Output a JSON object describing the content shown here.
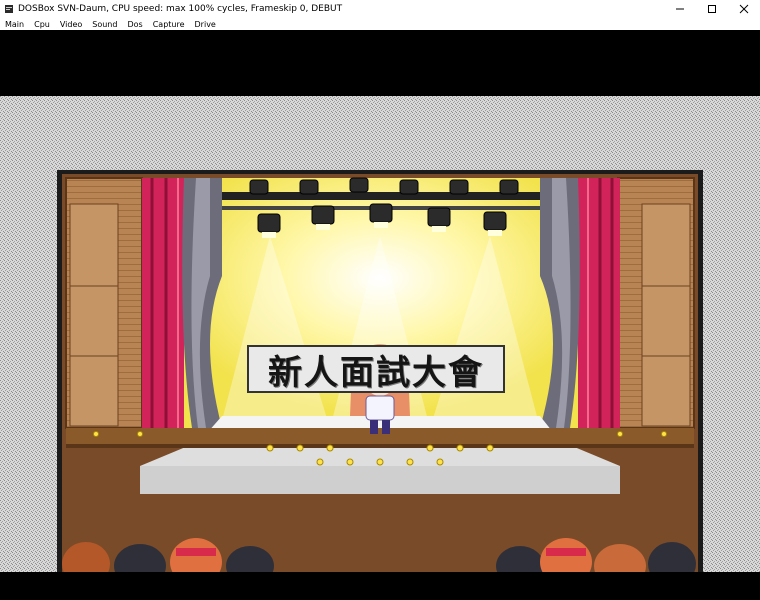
{
  "window": {
    "title": "DOSBox SVN-Daum, CPU speed: max 100% cycles, Frameskip  0,    DEBUT",
    "icon": "dosbox-icon",
    "controls": {
      "minimize": "—",
      "maximize": "☐",
      "close": "✕"
    }
  },
  "menu": {
    "items": [
      {
        "label": "Main"
      },
      {
        "label": "Cpu"
      },
      {
        "label": "Video"
      },
      {
        "label": "Sound"
      },
      {
        "label": "Dos"
      },
      {
        "label": "Capture"
      },
      {
        "label": "Drive"
      }
    ]
  },
  "game": {
    "banner_text": "新人面試大會",
    "colors": {
      "curtain": "#d2245a",
      "stage_glow": "#fff36a",
      "frame_bg": "#cfcfcf",
      "wood": "#b88453"
    }
  }
}
